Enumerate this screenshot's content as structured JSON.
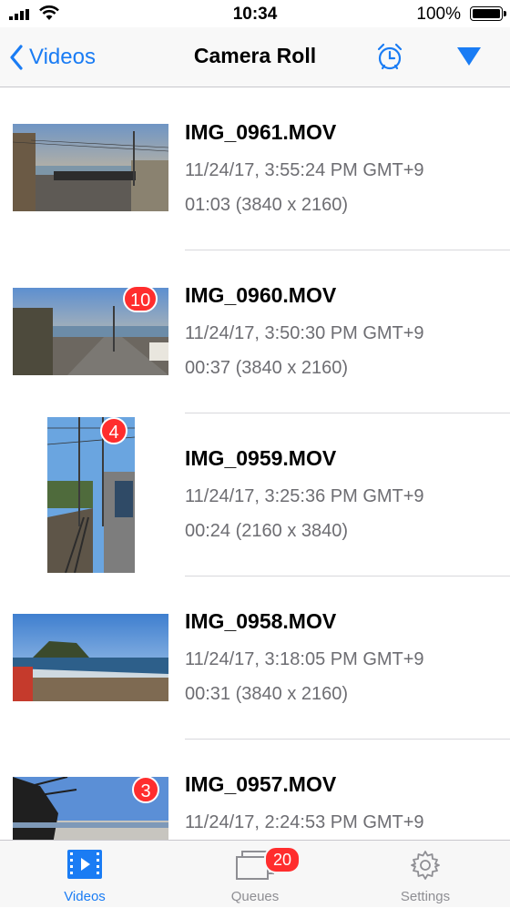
{
  "status_bar": {
    "time": "10:34",
    "battery": "100%"
  },
  "nav": {
    "back_label": "Videos",
    "title": "Camera Roll"
  },
  "videos": [
    {
      "name": "IMG_0961.MOV",
      "date": "11/24/17, 3:55:24 PM GMT+9",
      "info": "01:03 (3840 x 2160)",
      "badge": ""
    },
    {
      "name": "IMG_0960.MOV",
      "date": "11/24/17, 3:50:30 PM GMT+9",
      "info": "00:37 (3840 x 2160)",
      "badge": "10"
    },
    {
      "name": "IMG_0959.MOV",
      "date": "11/24/17, 3:25:36 PM GMT+9",
      "info": "00:24 (2160 x 3840)",
      "badge": "4"
    },
    {
      "name": "IMG_0958.MOV",
      "date": "11/24/17, 3:18:05 PM GMT+9",
      "info": "00:31 (3840 x 2160)",
      "badge": ""
    },
    {
      "name": "IMG_0957.MOV",
      "date": "11/24/17, 2:24:53 PM GMT+9",
      "info": "",
      "badge": "3"
    }
  ],
  "tabs": [
    {
      "label": "Videos",
      "icon": "video-icon",
      "active": true
    },
    {
      "label": "Queues",
      "icon": "queues-icon",
      "badge": "20"
    },
    {
      "label": "Settings",
      "icon": "gear-icon"
    }
  ],
  "colors": {
    "accent": "#1a7cf4",
    "badge": "#ff2d2d",
    "secondary_text": "#6d6d72"
  }
}
